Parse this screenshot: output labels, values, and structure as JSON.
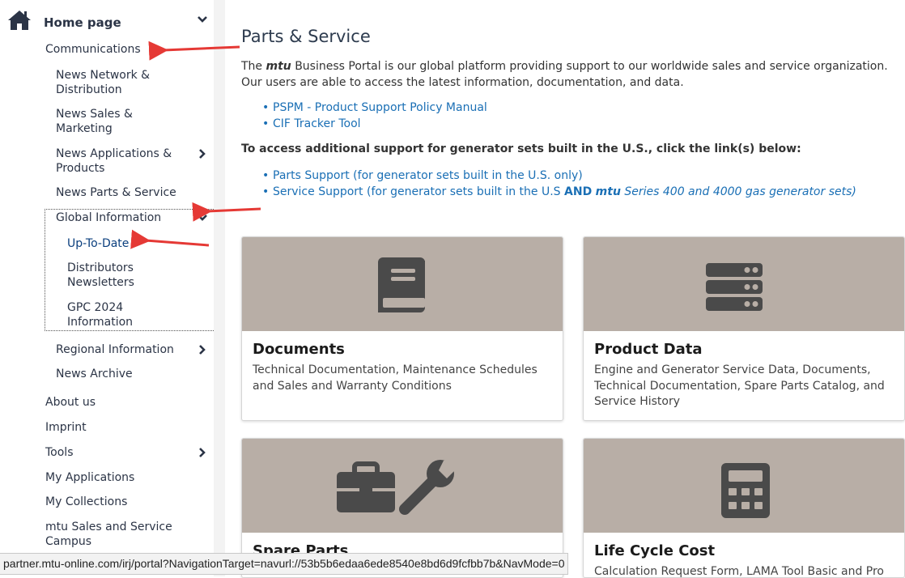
{
  "sidebar": {
    "home_label": "Home page",
    "items": [
      {
        "label": "Communications"
      },
      {
        "label": "News Network &\nDistribution"
      },
      {
        "label": "News Sales &\nMarketing"
      },
      {
        "label": "News Applications &\nProducts"
      },
      {
        "label": "News Parts & Service"
      },
      {
        "label": "Global Information"
      },
      {
        "label": "Up-To-Date"
      },
      {
        "label": "Distributors\nNewsletters"
      },
      {
        "label": "GPC 2024\nInformation"
      },
      {
        "label": "Regional Information"
      },
      {
        "label": "News Archive"
      },
      {
        "label": "About us"
      },
      {
        "label": "Imprint"
      },
      {
        "label": "Tools"
      },
      {
        "label": "My Applications"
      },
      {
        "label": "My Collections"
      },
      {
        "label": "mtu Sales and Service\nCampus"
      }
    ]
  },
  "main": {
    "title": "Parts & Service",
    "intro_before": "The ",
    "intro_brand": "mtu",
    "intro_after": " Business Portal is our global platform providing support to our worldwide sales and service organization. Our users are able to access the latest information, documentation, and data.",
    "links": [
      "PSPM - Product Support Policy Manual",
      "CIF Tracker Tool"
    ],
    "support_heading": "To access additional support for generator sets built in the U.S., click the link(s) below:",
    "parts_support": "Parts Support (for generator sets built in the U.S. only)",
    "service_support": {
      "part1": "Service Support (for generator sets built in the U.S ",
      "and": "AND",
      "mtu": "mtu",
      "part2": " Series 400 and 4000 gas generator sets)"
    },
    "cards": [
      {
        "title": "Documents",
        "desc": "Technical Documentation, Maintenance Schedules and Sales and Warranty Conditions",
        "icon": "book-icon"
      },
      {
        "title": "Product Data",
        "desc": "Engine and Generator Service Data, Documents, Technical Documentation, Spare Parts Catalog, and Service History",
        "icon": "server-icon"
      },
      {
        "title": "Spare Parts",
        "desc": "",
        "icon": "toolbox-wrench-icon"
      },
      {
        "title": "Life Cycle Cost",
        "desc": "Calculation Request Form, LAMA Tool Basic and Pro",
        "icon": "calculator-icon"
      }
    ]
  },
  "statusbar": {
    "url": "partner.mtu-online.com/irj/portal?NavigationTarget=navurl://53b5b6edaa6ede8540e8bd6d9fcfbb7b&NavMode=0"
  },
  "colors": {
    "card_image_bg": "#b8aea6",
    "icon_fill": "#4a4a4a",
    "link": "#1a6fb5",
    "arrow": "#e53935"
  }
}
